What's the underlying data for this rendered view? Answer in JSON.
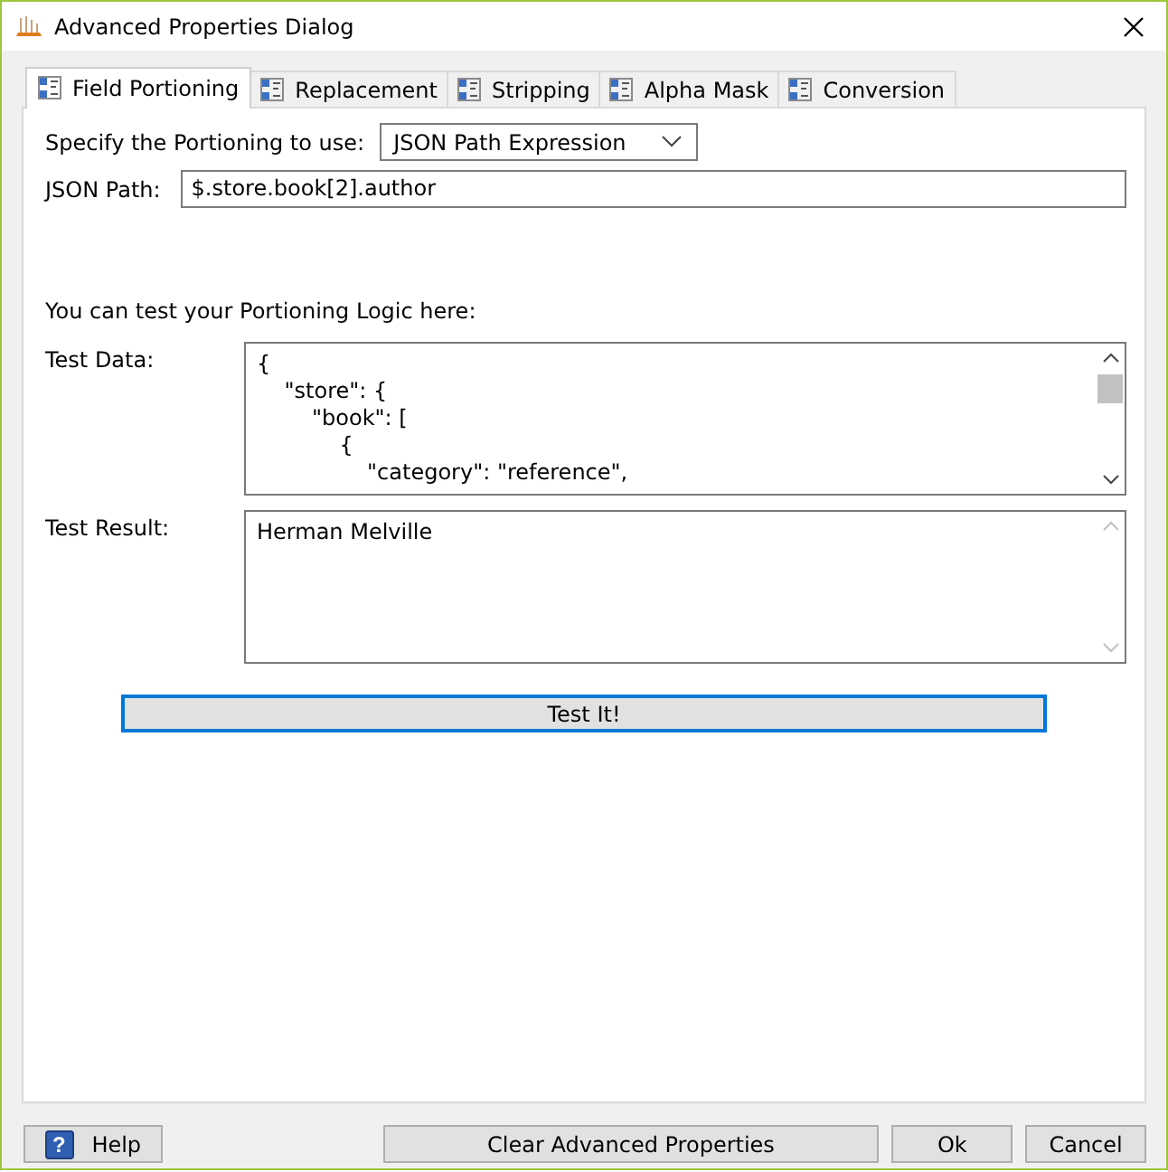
{
  "window": {
    "title": "Advanced Properties Dialog"
  },
  "tabs": [
    {
      "label": "Field Portioning",
      "selected": true
    },
    {
      "label": "Replacement",
      "selected": false
    },
    {
      "label": "Stripping",
      "selected": false
    },
    {
      "label": "Alpha Mask",
      "selected": false
    },
    {
      "label": "Conversion",
      "selected": false
    }
  ],
  "portioning": {
    "label": "Specify the Portioning to use:",
    "value": "JSON Path Expression"
  },
  "json_path": {
    "label": "JSON Path:",
    "value": "$.store.book[2].author"
  },
  "test_intro": "You can test your Portioning Logic here:",
  "test_data": {
    "label": "Test Data:",
    "lines": [
      "{",
      "    \"store\": {",
      "        \"book\": [",
      "            {",
      "                \"category\": \"reference\","
    ]
  },
  "test_result": {
    "label": "Test Result:",
    "value": "Herman Melville"
  },
  "test_button": "Test It!",
  "buttons": [
    {
      "kind": "help",
      "label": "Help",
      "icon": "?"
    },
    {
      "kind": "clear",
      "label": "Clear Advanced Properties"
    },
    {
      "kind": "ok",
      "label": "Ok"
    },
    {
      "kind": "cancel",
      "label": "Cancel"
    }
  ]
}
